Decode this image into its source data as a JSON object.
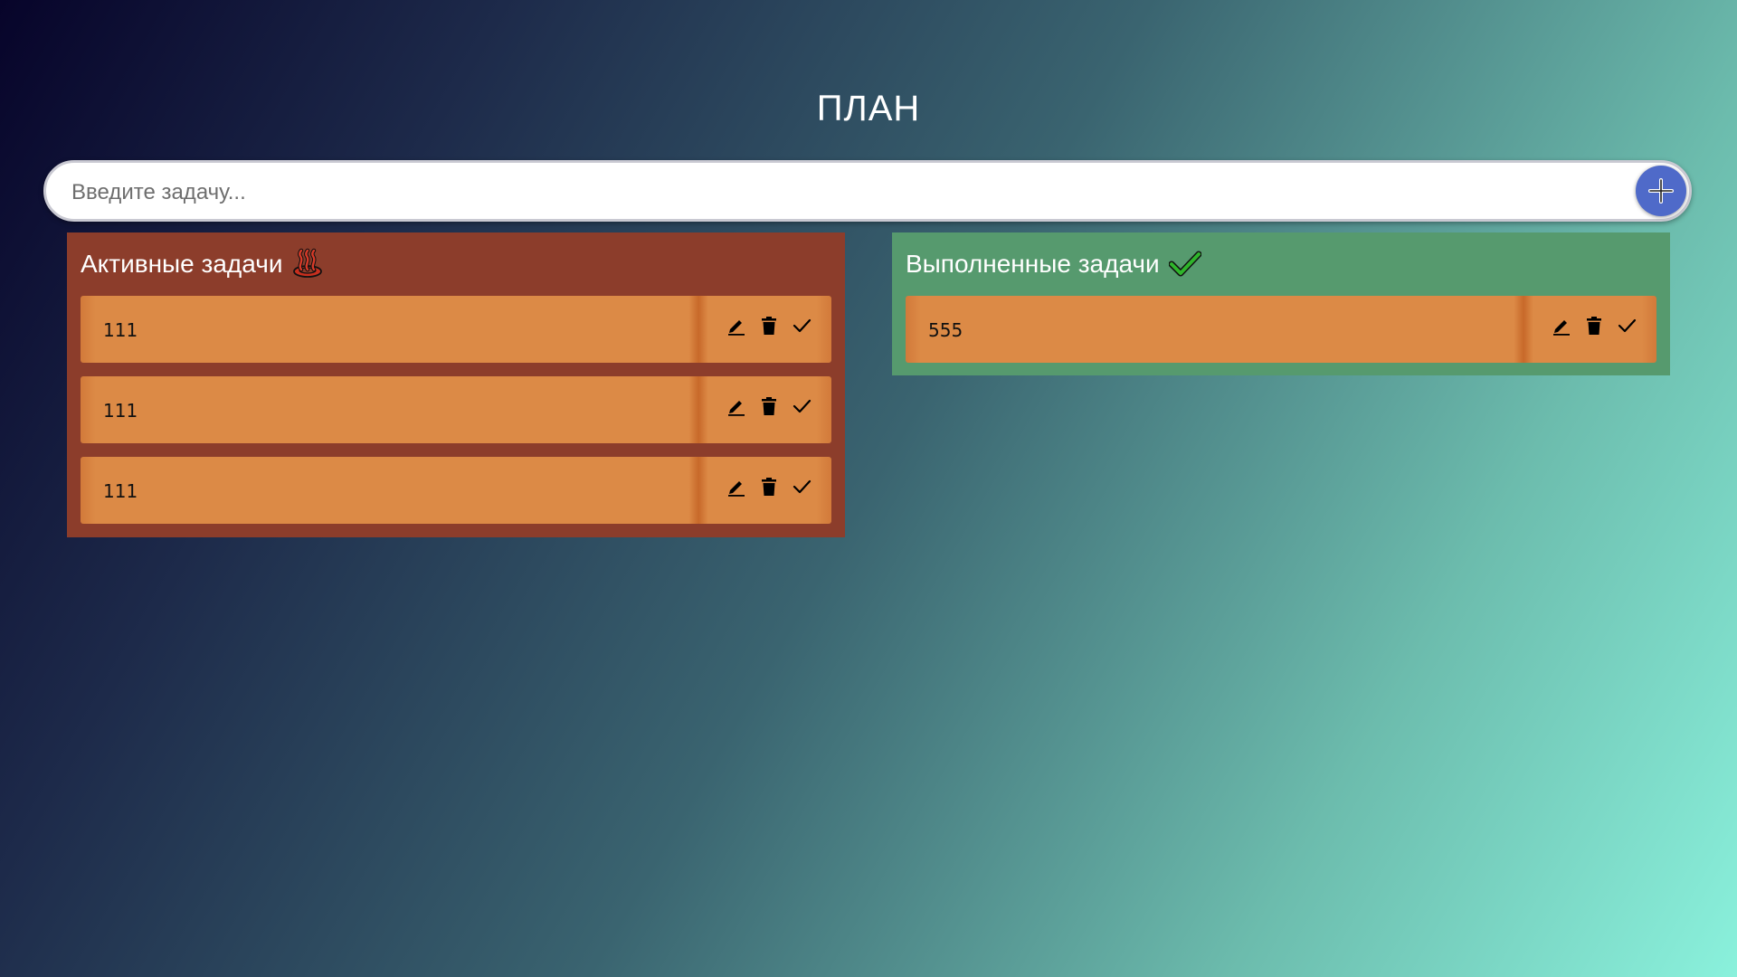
{
  "app": {
    "title": "ПЛАН"
  },
  "input": {
    "placeholder": "Введите задачу..."
  },
  "panels": {
    "active": {
      "title": "Активные задачи",
      "icon": "hot-springs-icon",
      "color": "#8c3d2b",
      "tasks": [
        {
          "text": "111"
        },
        {
          "text": "111"
        },
        {
          "text": "111"
        }
      ]
    },
    "done": {
      "title": "Выполненные задачи",
      "icon": "check-mark-icon",
      "color": "#569a6e",
      "tasks": [
        {
          "text": "555"
        }
      ]
    }
  },
  "colors": {
    "card": "#dc8a46",
    "add_button": "#4f6ac9"
  }
}
